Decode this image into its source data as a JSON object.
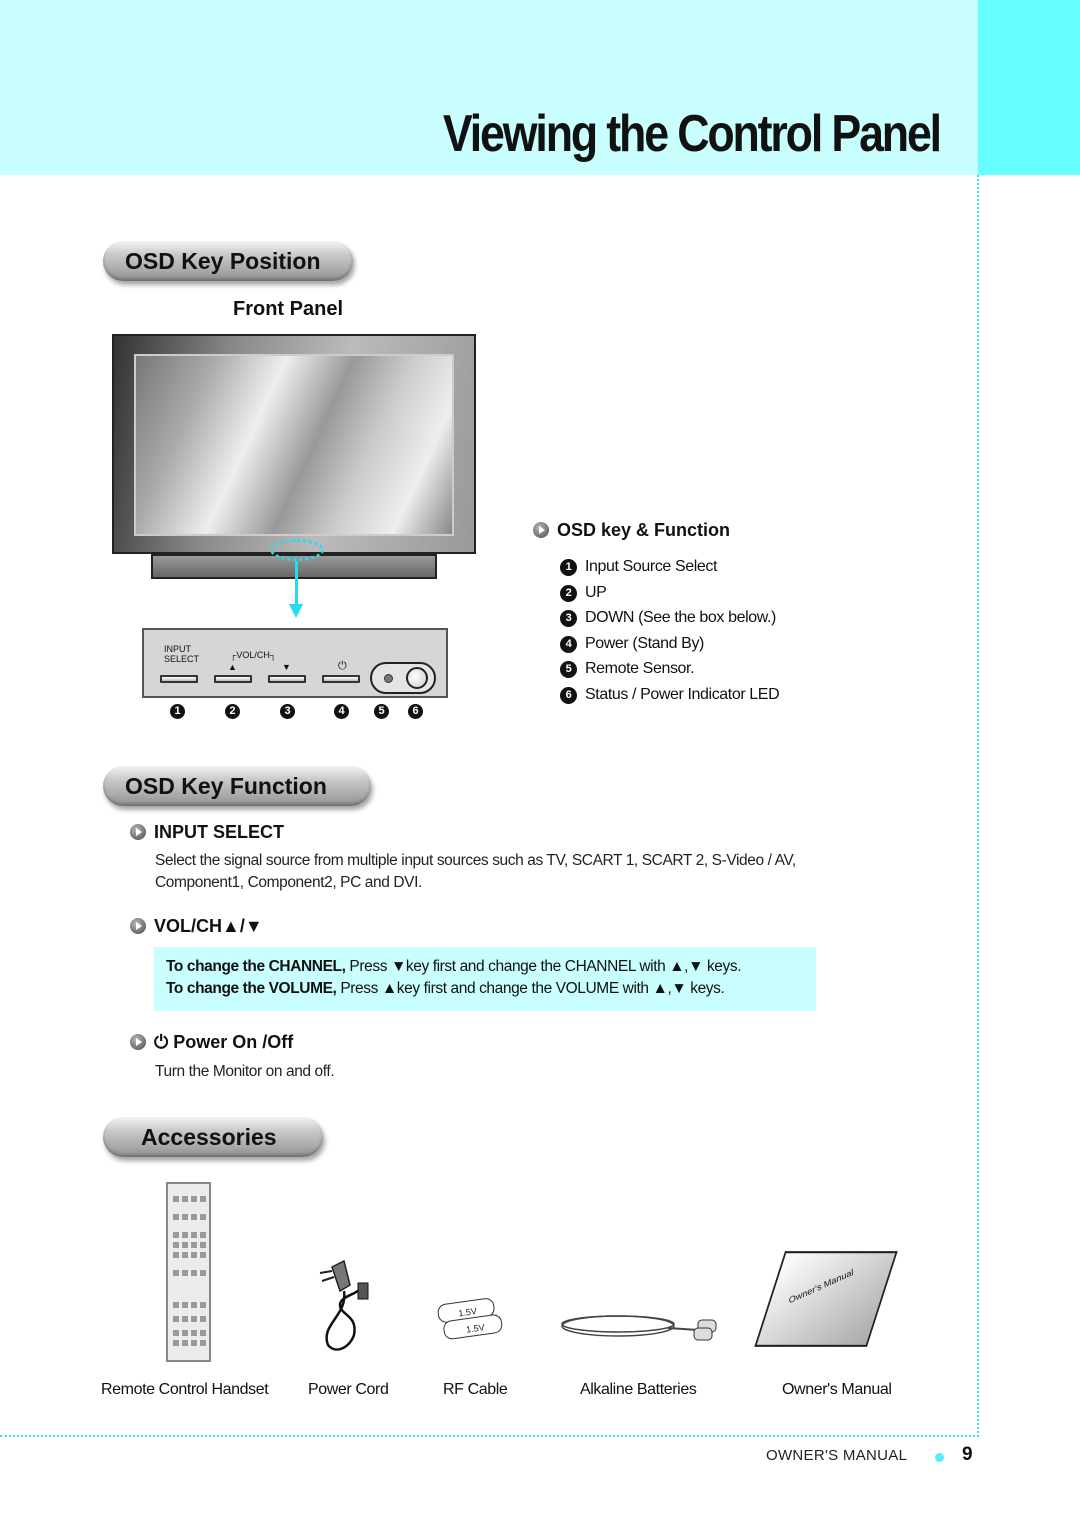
{
  "header": {
    "title": "Viewing the Control Panel"
  },
  "colors": {
    "header_band": "#c9ffff",
    "header_tab": "#66ffff",
    "accent_dotted": "#33e0ee",
    "info_box": "#c9ffff"
  },
  "sections": {
    "osd_key_position": {
      "title": "OSD Key Position",
      "subtitle": "Front Panel",
      "panel": {
        "input_label_line1": "INPUT",
        "input_label_line2": "SELECT",
        "volch_label": "VOL/CH",
        "up_glyph": "▲",
        "down_glyph": "▼",
        "power_glyph": "⏻",
        "numbers": [
          "1",
          "2",
          "3",
          "4",
          "5",
          "6"
        ]
      },
      "key_function": {
        "heading": "OSD key & Function",
        "items": [
          {
            "num": "1",
            "label": "Input Source Select"
          },
          {
            "num": "2",
            "label": "UP"
          },
          {
            "num": "3",
            "label": "DOWN (See the box below.)"
          },
          {
            "num": "4",
            "label": "Power (Stand By)"
          },
          {
            "num": "5",
            "label": "Remote Sensor."
          },
          {
            "num": "6",
            "label": "Status / Power Indicator LED"
          }
        ]
      }
    },
    "osd_key_function": {
      "title": "OSD Key Function",
      "input_select": {
        "heading": "INPUT SELECT",
        "line1": "Select the signal source from multiple input sources such as TV, SCART 1, SCART 2, S-Video / AV,",
        "line2": "Component1, Component2, PC and DVI."
      },
      "volch": {
        "heading": "VOL/CH▲/▼",
        "channel_bold": "To change the CHANNEL,",
        "channel_text": " Press ▼key first and change the CHANNEL with ▲,▼ keys.",
        "volume_bold": "To change the VOLUME,",
        "volume_text": " Press ▲key first and change the VOLUME with ▲,▼ keys."
      },
      "power": {
        "heading": "⏻ Power On /Off",
        "text": "Turn the Monitor on and off."
      }
    },
    "accessories": {
      "title": "Accessories",
      "items": [
        {
          "label": "Remote Control Handset"
        },
        {
          "label": "Power Cord"
        },
        {
          "label": "RF Cable"
        },
        {
          "label": "Alkaline Batteries"
        },
        {
          "label": "Owner's Manual"
        }
      ],
      "battery_text": "1.5V",
      "manual_cover_text": "Owner's Manual"
    }
  },
  "footer": {
    "label": "OWNER'S MANUAL",
    "page_number": "9"
  }
}
